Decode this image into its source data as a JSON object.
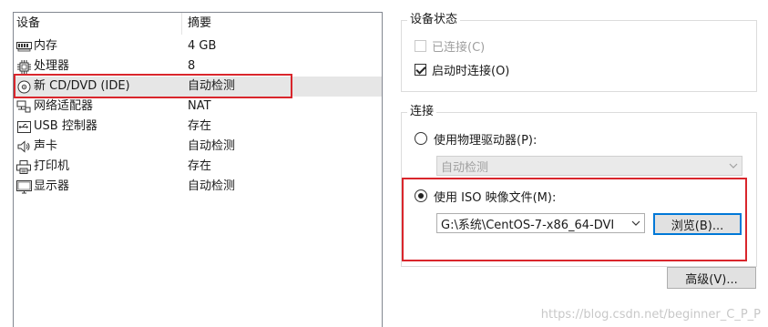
{
  "device_list": {
    "headers": {
      "device": "设备",
      "summary": "摘要"
    },
    "rows": [
      {
        "icon": "memory-icon",
        "name": "内存",
        "summary": "4 GB"
      },
      {
        "icon": "cpu-icon",
        "name": "处理器",
        "summary": "8"
      },
      {
        "icon": "cd-dvd-icon",
        "name": "新 CD/DVD (IDE)",
        "summary": "自动检测"
      },
      {
        "icon": "network-adapter-icon",
        "name": "网络适配器",
        "summary": "NAT"
      },
      {
        "icon": "usb-icon",
        "name": "USB 控制器",
        "summary": "存在"
      },
      {
        "icon": "sound-card-icon",
        "name": "声卡",
        "summary": "自动检测"
      },
      {
        "icon": "printer-icon",
        "name": "打印机",
        "summary": "存在"
      },
      {
        "icon": "display-icon",
        "name": "显示器",
        "summary": "自动检测"
      }
    ],
    "selected_index": 2
  },
  "device_status": {
    "title": "设备状态",
    "connected_label": "已连接(C)",
    "connected_checked": false,
    "connect_on_power_on_label": "启动时连接(O)",
    "connect_on_power_on_checked": true
  },
  "connection": {
    "title": "连接",
    "physical_drive_label": "使用物理驱动器(P):",
    "physical_drive_value": "自动检测",
    "iso_label": "使用 ISO 映像文件(M):",
    "iso_path": "G:\\系统\\CentOS-7-x86_64-DVI",
    "browse_label": "浏览(B)...",
    "selected": "iso"
  },
  "advanced_label": "高级(V)...",
  "watermark": "https://blog.csdn.net/beginner_C_P_P",
  "colors": {
    "highlight_box": "#d9262c",
    "selected_row": "#e6e6e6",
    "focus_border": "#0078d7"
  }
}
